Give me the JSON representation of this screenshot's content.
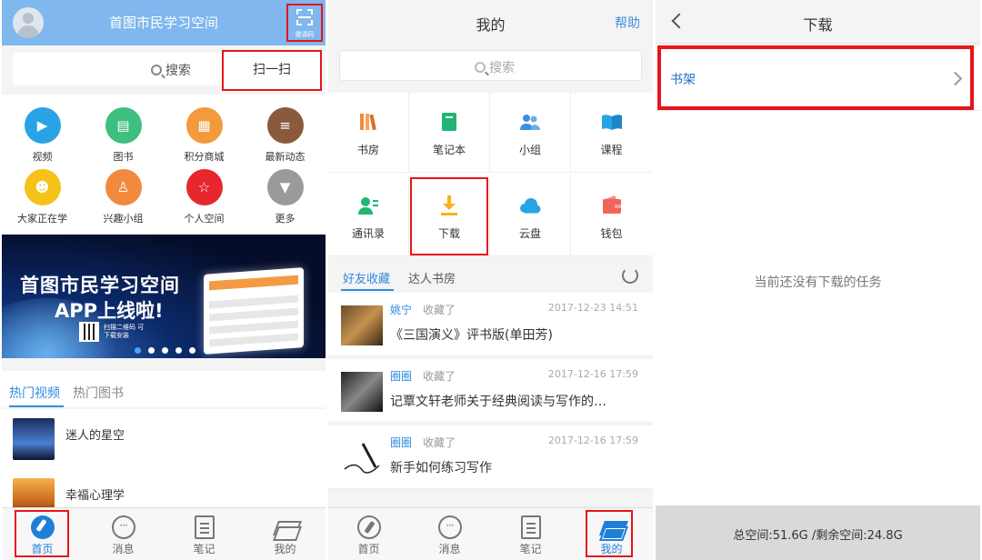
{
  "colors": {
    "highlight": "#e8141b",
    "accent_blue": "#2f8be0",
    "top_bar": "#7fb7ee"
  },
  "panel1": {
    "title": "首图市民学习空间",
    "qr_label": "邀请码",
    "search_label": "搜索",
    "scan_label": "扫一扫",
    "grid": [
      {
        "label": "视频",
        "icon": "video-camera-icon",
        "color": "#29a3e6"
      },
      {
        "label": "图书",
        "icon": "book-icon",
        "color": "#3fbf7f"
      },
      {
        "label": "积分商城",
        "icon": "store-icon",
        "color": "#f29a3d"
      },
      {
        "label": "最新动态",
        "icon": "news-icon",
        "color": "#8a5a3c"
      },
      {
        "label": "大家正在学",
        "icon": "reading-person-icon",
        "color": "#f5c219"
      },
      {
        "label": "兴趣小组",
        "icon": "group-icon",
        "color": "#f28a3d"
      },
      {
        "label": "个人空间",
        "icon": "star-icon",
        "color": "#e8262e"
      },
      {
        "label": "更多",
        "icon": "more-arrow-icon",
        "color": "#9a9a9a"
      }
    ],
    "banner": {
      "title": "首图市民学习空间",
      "subtitle": "APP上线啦!",
      "qr_text": "扫描二维码 可下载安装"
    },
    "tabs": [
      "热门视频",
      "热门图书"
    ],
    "list": [
      {
        "title": "迷人的星空"
      },
      {
        "title": "幸福心理学"
      }
    ]
  },
  "tabbar": [
    "首页",
    "消息",
    "笔记",
    "我的"
  ],
  "panel2": {
    "title": "我的",
    "help": "帮助",
    "search_placeholder": "搜索",
    "grid": [
      {
        "label": "书房",
        "icon": "bookshelf-icon",
        "color": "#f28a3d"
      },
      {
        "label": "笔记本",
        "icon": "notebook-icon",
        "color": "#22b573"
      },
      {
        "label": "小组",
        "icon": "group-icon",
        "color": "#3f8fe0"
      },
      {
        "label": "课程",
        "icon": "open-book-icon",
        "color": "#29a3e6"
      },
      {
        "label": "通讯录",
        "icon": "contacts-icon",
        "color": "#22b573"
      },
      {
        "label": "下载",
        "icon": "download-icon",
        "color": "#f5b21a"
      },
      {
        "label": "云盘",
        "icon": "cloud-icon",
        "color": "#29a3e6"
      },
      {
        "label": "钱包",
        "icon": "wallet-icon",
        "color": "#f0655a"
      }
    ],
    "subtabs": [
      "好友收藏",
      "达人书房"
    ],
    "feed": [
      {
        "name": "姚宁",
        "action": "收藏了",
        "time": "2017-12-23 14:51",
        "title": "《三国演义》评书版(单田芳)"
      },
      {
        "name": "圈圈",
        "action": "收藏了",
        "time": "2017-12-16 17:59",
        "title": "记覃文轩老师关于经典阅读与写作的…"
      },
      {
        "name": "圈圈",
        "action": "收藏了",
        "time": "2017-12-16 17:59",
        "title": "新手如何练习写作"
      }
    ]
  },
  "panel3": {
    "title": "下载",
    "shelf_label": "书架",
    "empty_text": "当前还没有下载的任务",
    "storage": "总空间:51.6G /剩余空间:24.8G"
  }
}
